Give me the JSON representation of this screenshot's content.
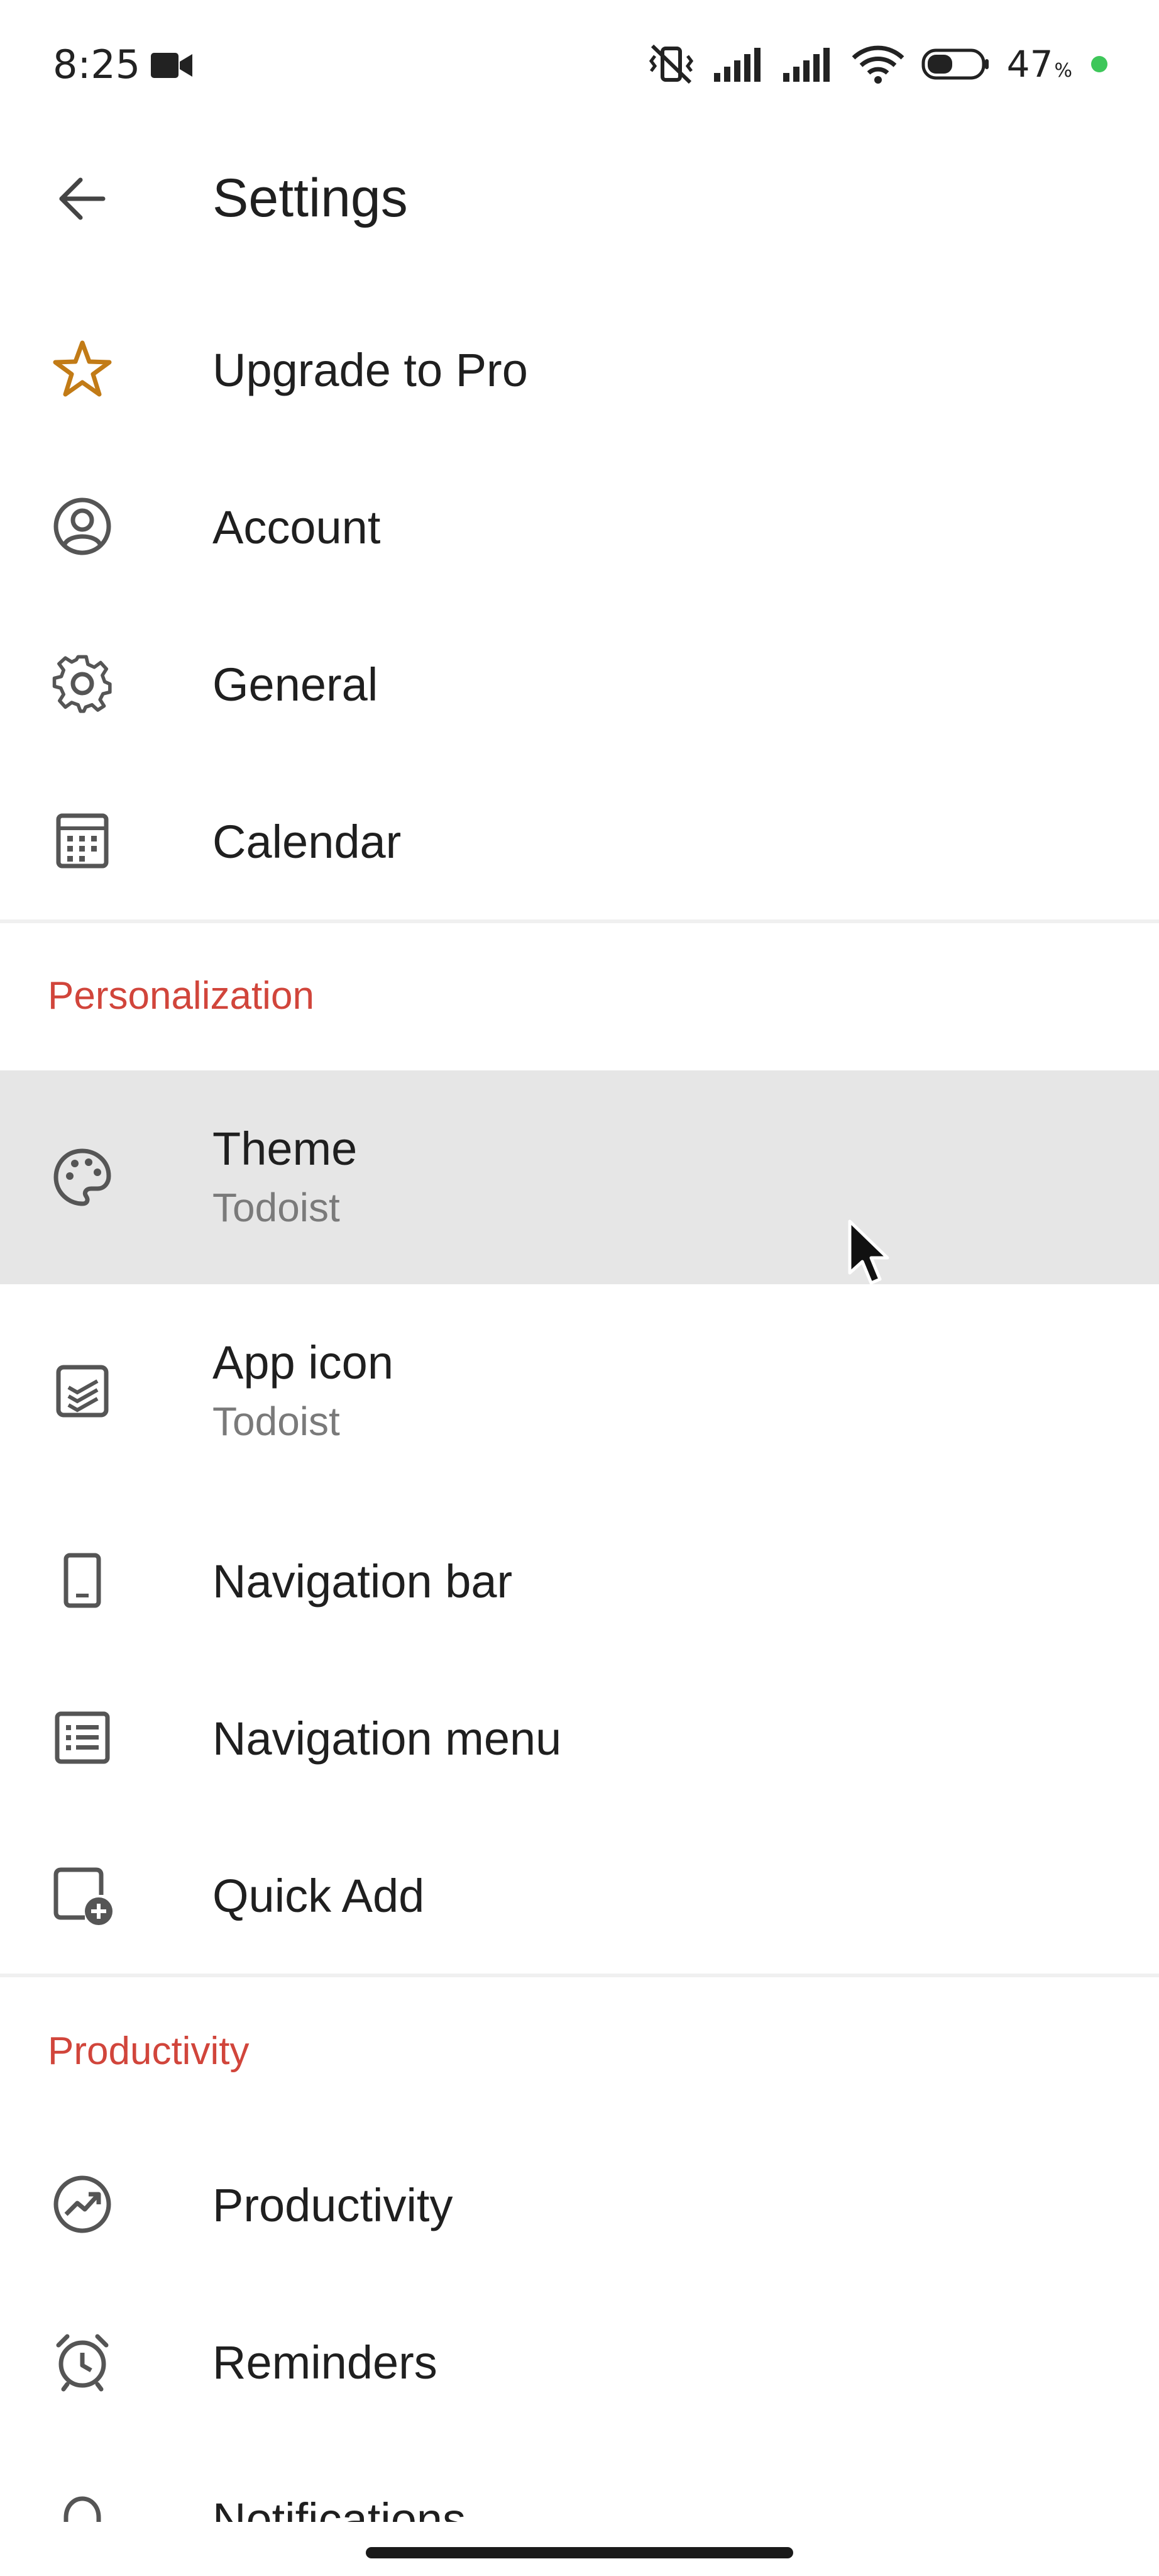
{
  "status_bar": {
    "time": "8:25",
    "battery_percent": "47",
    "battery_unit": "%",
    "battery_level": 0.47,
    "icons": [
      "video-camera-icon",
      "vibrate-off-icon",
      "signal-icon",
      "signal-icon",
      "wifi-icon",
      "battery-icon"
    ],
    "dot_color": "#3ec75a"
  },
  "app_bar": {
    "title": "Settings",
    "back_icon": "arrow-left-icon"
  },
  "colors": {
    "accent": "#d1453b",
    "star": "#c27b16",
    "highlight": "#e6e6e6"
  },
  "sections": {
    "personalization": "Personalization",
    "productivity": "Productivity"
  },
  "items": {
    "upgrade": {
      "label": "Upgrade to Pro",
      "icon": "star-icon"
    },
    "account": {
      "label": "Account",
      "icon": "account-circle-icon"
    },
    "general": {
      "label": "General",
      "icon": "gear-icon"
    },
    "calendar": {
      "label": "Calendar",
      "icon": "calendar-icon"
    },
    "theme": {
      "label": "Theme",
      "value": "Todoist",
      "icon": "palette-icon"
    },
    "app_icon": {
      "label": "App icon",
      "value": "Todoist",
      "icon": "app-icon-icon"
    },
    "navigation_bar": {
      "label": "Navigation bar",
      "icon": "phone-icon"
    },
    "navigation_menu": {
      "label": "Navigation menu",
      "icon": "list-icon"
    },
    "quick_add": {
      "label": "Quick Add",
      "icon": "add-task-icon"
    },
    "productivity": {
      "label": "Productivity",
      "icon": "trend-icon"
    },
    "reminders": {
      "label": "Reminders",
      "icon": "alarm-icon"
    },
    "notifications": {
      "label": "Notifications",
      "icon": "bell-icon"
    }
  }
}
